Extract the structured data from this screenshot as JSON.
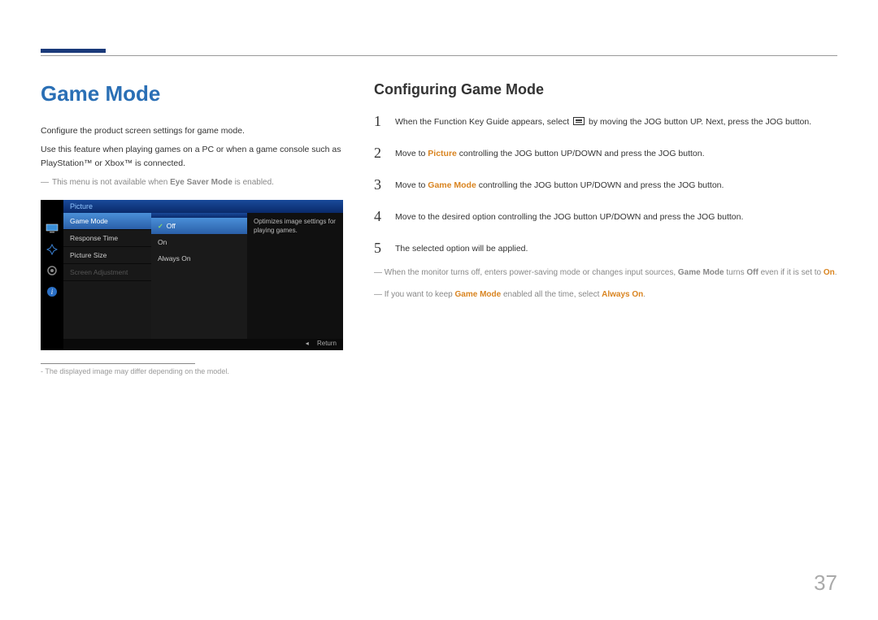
{
  "page_number": "37",
  "left": {
    "title": "Game Mode",
    "para1": "Configure the product screen settings for game mode.",
    "para2": "Use this feature when playing games on a PC or when a game console such as PlayStation™ or Xbox™ is connected.",
    "note1_prefix": "―",
    "note1_a": "This menu is not available when ",
    "note1_bold": "Eye Saver Mode",
    "note1_b": " is enabled.",
    "footnote_prefix": "-",
    "footnote": "The displayed image may differ depending on the model."
  },
  "screenshot": {
    "header": "Picture",
    "menu": [
      "Game Mode",
      "Response Time",
      "Picture Size",
      "Screen Adjustment"
    ],
    "options": [
      "Off",
      "On",
      "Always On"
    ],
    "desc": "Optimizes image settings for playing games.",
    "footer_arrow": "◂",
    "footer_return": "Return"
  },
  "right": {
    "title": "Configuring Game Mode",
    "steps": [
      {
        "num": "1",
        "t1": "When the Function Key Guide appears, select ",
        "t2": " by moving the JOG button UP. Next, press the JOG button."
      },
      {
        "num": "2",
        "t1": "Move to ",
        "orange": "Picture",
        "t2": " controlling the JOG button UP/DOWN and press the JOG button."
      },
      {
        "num": "3",
        "t1": "Move to ",
        "orange": "Game Mode",
        "t2": " controlling the JOG button UP/DOWN and press the JOG button."
      },
      {
        "num": "4",
        "t1": "Move to the desired option controlling the JOG button UP/DOWN and press the JOG button."
      },
      {
        "num": "5",
        "t1": "The selected option will be applied."
      }
    ],
    "note2_prefix": "―",
    "note2_a": "When the monitor turns off, enters power-saving mode or changes input sources, ",
    "note2_b1": "Game Mode",
    "note2_c": " turns ",
    "note2_b2": "Off",
    "note2_d": " even if it is set to ",
    "note2_orange": "On",
    "note2_e": ".",
    "note3_prefix": "―",
    "note3_a": "If you want to keep ",
    "note3_orange1": "Game Mode",
    "note3_b": " enabled all the time, select ",
    "note3_orange2": "Always On",
    "note3_c": "."
  }
}
